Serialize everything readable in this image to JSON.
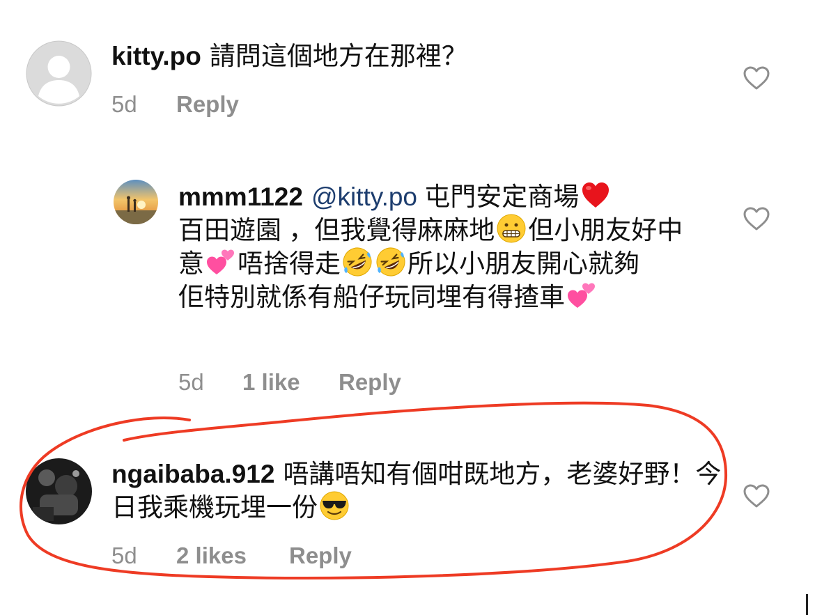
{
  "comments": [
    {
      "username": "kitty.po",
      "text": "請問這個地方在那裡？",
      "time": "5d",
      "reply_label": "Reply"
    },
    {
      "username": "mmm1122",
      "mention": "@kitty.po",
      "text_parts": [
        "屯門安定商場",
        "百田遊園 ，但我覺得麻麻地",
        "但小朋友好中意",
        "唔捨得走",
        "所以小朋友開心就夠",
        "佢特別就係有船仔玩同埋有得揸車"
      ],
      "emojis": [
        "red-heart",
        "grimacing-face",
        "two-hearts",
        "rolling-laughing-face",
        "rolling-laughing-face",
        "two-hearts"
      ],
      "time": "5d",
      "likes": "1 like",
      "reply_label": "Reply"
    },
    {
      "username": "ngaibaba.912",
      "text_parts": [
        "唔講唔知有個咁既地方，老婆好野！今日我乘機玩埋一份"
      ],
      "emojis": [
        "sunglasses-face"
      ],
      "time": "5d",
      "likes": "2 likes",
      "reply_label": "Reply"
    }
  ],
  "colors": {
    "meta_grey": "#8e8e8e",
    "mention_blue": "#1d3d6e",
    "annotation_red": "#ee3b24"
  }
}
